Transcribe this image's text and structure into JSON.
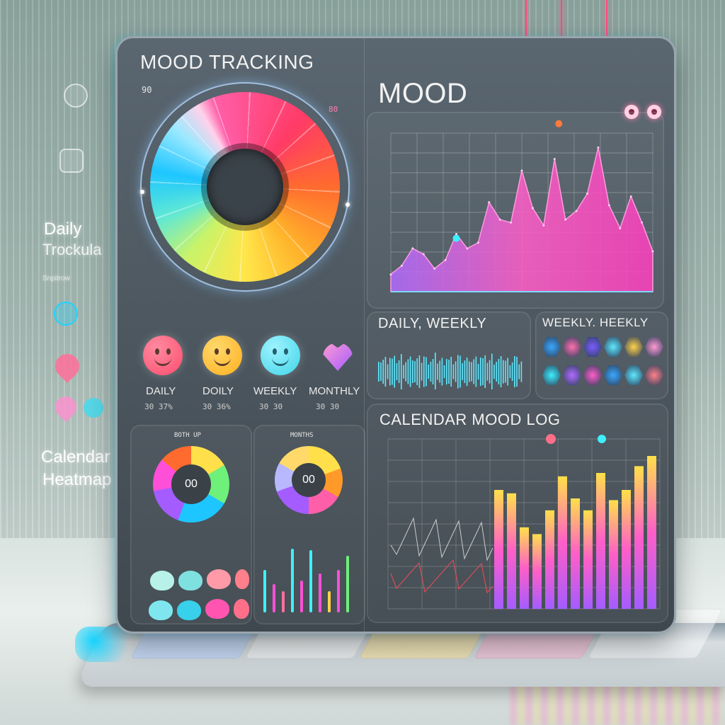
{
  "side": {
    "daily_label": "Daily",
    "tracking_label": "Trockula",
    "small_text": "Snpitrow",
    "calendar_label": "Calendar",
    "heatmap_label": "Heatmap"
  },
  "app": {
    "title": "MOOD TRACKING",
    "corner_left": "90",
    "corner_right": "80"
  },
  "mood_section": {
    "title": "MOOD"
  },
  "emojis": [
    {
      "label": "DAILY",
      "sub": "30 37%",
      "color": "#ff4d6d",
      "type": "face"
    },
    {
      "label": "DOILY",
      "sub": "30 36%",
      "color": "#ffb020",
      "type": "face"
    },
    {
      "label": "WEEKLY",
      "sub": "30 30",
      "color": "#3fd6e8",
      "type": "face"
    },
    {
      "label": "MONTHLY",
      "sub": "30 30",
      "color": "#c85cff",
      "type": "heart"
    }
  ],
  "donut_panels": [
    {
      "title": "BOTH UP",
      "value": "00"
    },
    {
      "title": "MONTHS",
      "value": "00"
    }
  ],
  "daily_weekly": {
    "title": "DAILY, WEEKLY"
  },
  "weekly_heekly": {
    "title": "WEEKLY. HEEKLY"
  },
  "calendar": {
    "title": "CALENDAR MOOD LOG"
  },
  "accent": {
    "pink": "#ff4fd8",
    "cyan": "#1ed3ff",
    "orange": "#ff8c2a"
  },
  "chart_data": [
    {
      "type": "area",
      "title": "",
      "x": [
        0,
        1,
        2,
        3,
        4,
        5,
        6,
        7,
        8,
        9,
        10,
        11,
        12,
        13,
        14,
        15,
        16,
        17,
        18,
        19,
        20,
        21,
        22,
        23,
        24
      ],
      "values": [
        12,
        18,
        30,
        26,
        16,
        22,
        40,
        30,
        34,
        62,
        50,
        48,
        84,
        58,
        46,
        92,
        50,
        56,
        68,
        100,
        60,
        44,
        66,
        48,
        28
      ],
      "ylim": [
        0,
        110
      ],
      "grid": true
    },
    {
      "type": "bar",
      "title": "",
      "categories": [
        "1",
        "2",
        "3",
        "4",
        "5",
        "6",
        "7",
        "8",
        "9",
        "10",
        "11",
        "12",
        "13"
      ],
      "values": [
        70,
        68,
        48,
        44,
        58,
        78,
        65,
        58,
        80,
        64,
        70,
        84,
        90
      ],
      "ylim": [
        0,
        100
      ],
      "grid": true
    }
  ]
}
